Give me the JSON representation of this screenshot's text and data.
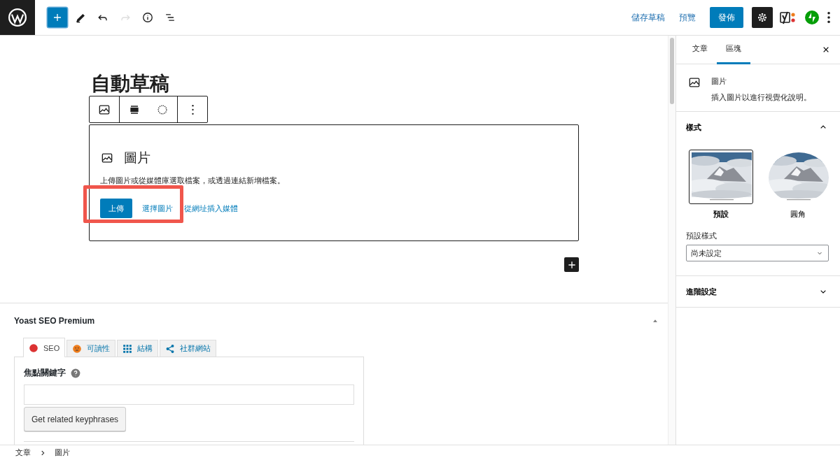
{
  "topbar": {
    "tools": [
      {
        "kind": "add",
        "selected": true,
        "disabled": false
      },
      {
        "kind": "edit",
        "selected": false,
        "disabled": false
      },
      {
        "kind": "undo",
        "selected": false,
        "disabled": false
      },
      {
        "kind": "redo",
        "selected": false,
        "disabled": true
      },
      {
        "kind": "info",
        "selected": false,
        "disabled": false
      },
      {
        "kind": "outline",
        "selected": false,
        "disabled": false
      }
    ],
    "save_draft": "儲存草稿",
    "preview": "預覽",
    "publish": "發佈",
    "settings_selected": true
  },
  "editor": {
    "title": "自動草稿",
    "image_block": {
      "label": "圖片",
      "instructions": "上傳圖片或從媒體庫選取檔案，或透過連結新增檔案。",
      "buttons": [
        {
          "label": "上傳",
          "kind": "primary"
        },
        {
          "label": "選擇圖片",
          "kind": "link"
        },
        {
          "label": "從網址插入媒體",
          "kind": "link"
        }
      ]
    }
  },
  "yoast": {
    "title": "Yoast SEO Premium",
    "expanded": true,
    "tabs": [
      {
        "label": "SEO",
        "kind": "score",
        "color": "#dc3232",
        "selected": true
      },
      {
        "label": "可讀性",
        "kind": "face",
        "color": "#ee7c1b",
        "selected": false
      },
      {
        "label": "結構",
        "kind": "grid",
        "selected": false
      },
      {
        "label": "社群網站",
        "kind": "share",
        "selected": false
      }
    ],
    "focus_keyphrase_label": "焦點關鍵字",
    "button": "Get related keyphrases"
  },
  "sidebar": {
    "tabs": [
      {
        "label": "文章",
        "selected": false
      },
      {
        "label": "區塊",
        "selected": true
      }
    ],
    "block_card": {
      "title": "圖片",
      "description": "插入圖片以進行視覺化說明。"
    },
    "panels": [
      {
        "kind": "styles",
        "title": "樣式",
        "expanded": true,
        "styles": [
          {
            "label": "預設",
            "kind": "default",
            "selected": true
          },
          {
            "label": "圓角",
            "kind": "rounded",
            "selected": false
          }
        ],
        "default_style_label": "預設樣式",
        "default_style_value": "尚未設定"
      },
      {
        "kind": "advanced",
        "title": "進階設定",
        "expanded": false
      }
    ]
  },
  "breadcrumb": [
    "文章",
    "圖片"
  ]
}
